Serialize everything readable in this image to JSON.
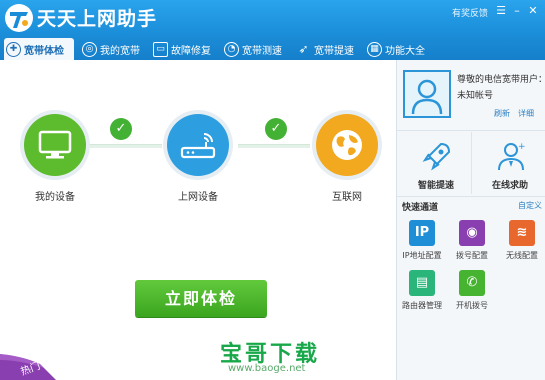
{
  "titlebar": {
    "app_title": "天天上网助手",
    "feedback": "有奖反馈"
  },
  "tabs": [
    {
      "label": "宽带体检",
      "icon": "stethoscope-icon",
      "active": true
    },
    {
      "label": "我的宽带",
      "icon": "globe-icon",
      "active": false
    },
    {
      "label": "故障修复",
      "icon": "toolbox-icon",
      "active": false
    },
    {
      "label": "宽带测速",
      "icon": "speedometer-icon",
      "active": false
    },
    {
      "label": "宽带提速",
      "icon": "rocket-icon",
      "active": false
    },
    {
      "label": "功能大全",
      "icon": "apps-icon",
      "active": false
    }
  ],
  "flow": {
    "nodes": [
      {
        "label": "我的设备",
        "icon": "monitor-icon",
        "color": "#5dbb2e"
      },
      {
        "label": "上网设备",
        "icon": "router-icon",
        "color": "#2d9ee0"
      },
      {
        "label": "互联网",
        "icon": "earth-icon",
        "color": "#f2a81f"
      }
    ],
    "status": [
      "ok",
      "ok"
    ]
  },
  "check_button": "立即体检",
  "hot_badge": "热门",
  "watermark": {
    "text": "宝哥下载",
    "url": "www.baoge.net"
  },
  "side": {
    "greeting": "尊敬的电信宽带用户：",
    "account": "未知帐号",
    "refresh": "刷新",
    "details": "详细",
    "actions": [
      {
        "label": "智能提速",
        "icon": "rocket-icon"
      },
      {
        "label": "在线求助",
        "icon": "support-agent-icon"
      }
    ],
    "quick_title": "快速通道",
    "custom": "自定义",
    "quick_items": [
      {
        "label": "IP地址配置",
        "glyph": "IP",
        "color": "#1e8fd6"
      },
      {
        "label": "拨号配置",
        "glyph": "◉",
        "color": "#8a3fb0"
      },
      {
        "label": "无线配置",
        "glyph": "≋",
        "color": "#e8672c"
      },
      {
        "label": "路由器管理",
        "glyph": "▤",
        "color": "#2ab57a"
      },
      {
        "label": "开机拨号",
        "glyph": "✆",
        "color": "#46b331"
      }
    ]
  }
}
